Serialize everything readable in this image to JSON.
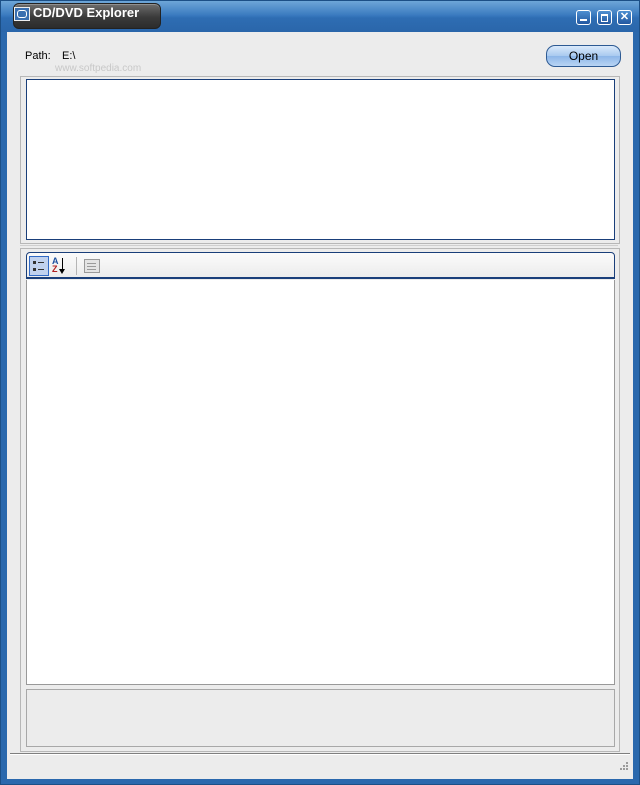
{
  "window": {
    "title": "CD/DVD Explorer",
    "watermark": "www.softpedia.com"
  },
  "path": {
    "label": "Path:",
    "value": "E:\\"
  },
  "open_button": {
    "label": "Open"
  },
  "property_toolbar": {
    "categorized": "categorized-view-icon",
    "alphabetical": "sort-az-icon",
    "property_pages": "property-pages-icon"
  },
  "colors": {
    "titlebar": "#2e6db3",
    "frame": "#2a68ad",
    "client": "#ececec",
    "panel_border": "#1a3f7a"
  }
}
